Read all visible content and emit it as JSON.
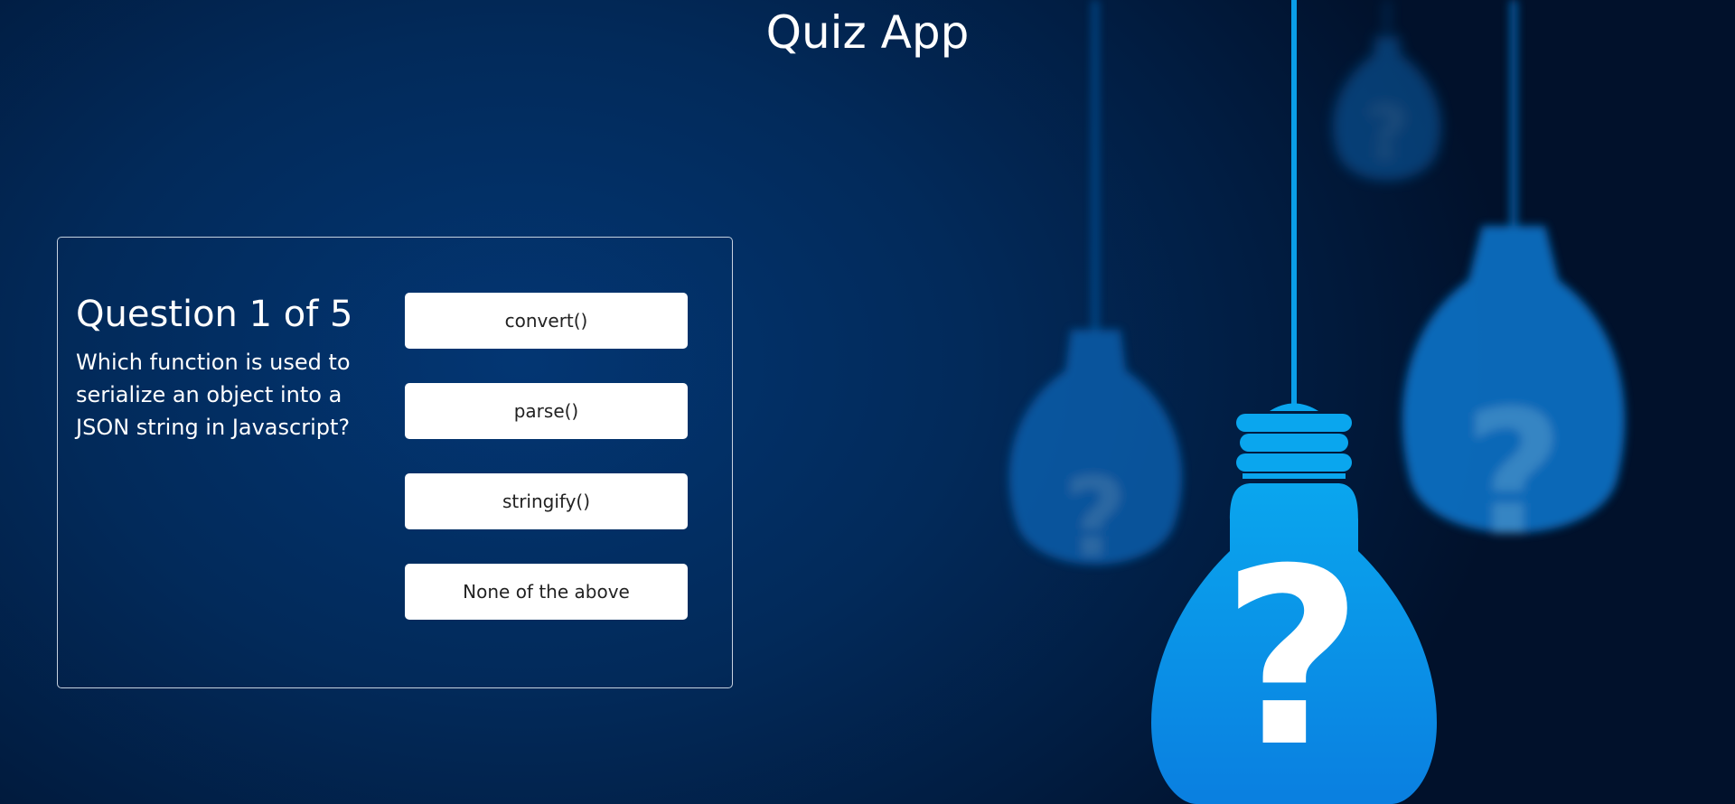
{
  "app": {
    "title": "Quiz App"
  },
  "quiz": {
    "question_count": "Question 1 of 5",
    "question_text": "Which function is used to serialize an object into a JSON string in Javascript?",
    "answers": [
      "convert()",
      "parse()",
      "stringify()",
      "None of the above"
    ]
  },
  "background": {
    "bulb_glyph": "?",
    "bulb_color": "#0a8ce8",
    "background_color": "#022a5a"
  }
}
